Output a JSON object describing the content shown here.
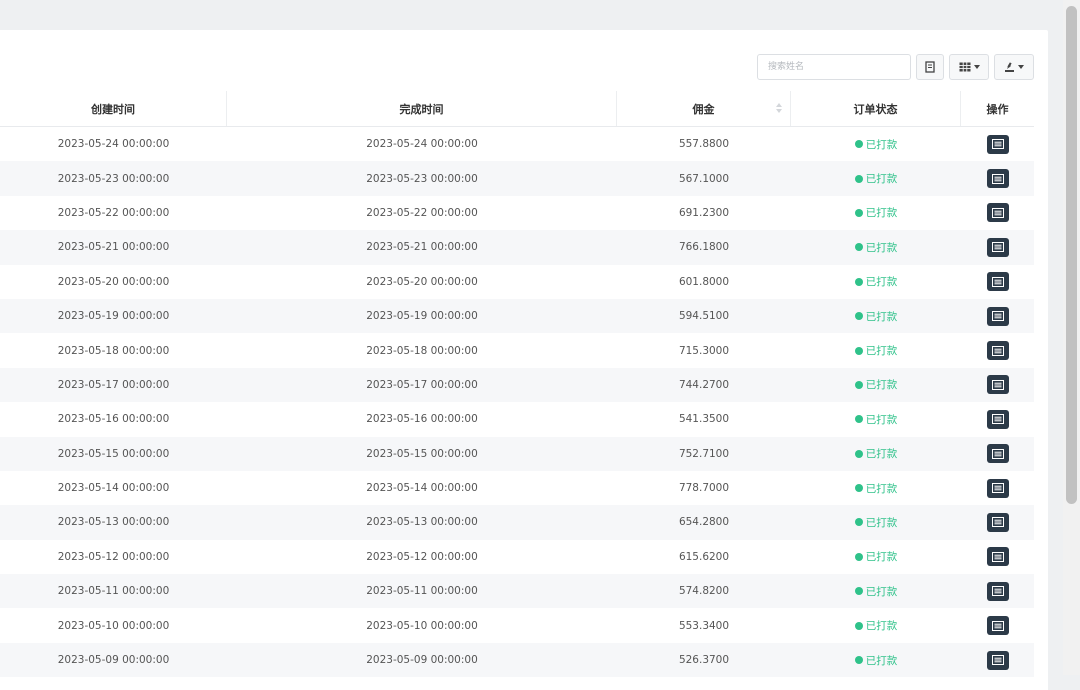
{
  "search": {
    "placeholder": "搜索姓名"
  },
  "toolbar": {
    "icons": [
      "refresh-icon",
      "columns-icon",
      "export-icon"
    ]
  },
  "table": {
    "headers": [
      "创建时间",
      "完成时间",
      "佣金",
      "订单状态",
      "操作"
    ],
    "rows": [
      {
        "created": "2023-05-24 00:00:00",
        "finished": "2023-05-24 00:00:00",
        "commission": "557.8800",
        "status": "已打款"
      },
      {
        "created": "2023-05-23 00:00:00",
        "finished": "2023-05-23 00:00:00",
        "commission": "567.1000",
        "status": "已打款"
      },
      {
        "created": "2023-05-22 00:00:00",
        "finished": "2023-05-22 00:00:00",
        "commission": "691.2300",
        "status": "已打款"
      },
      {
        "created": "2023-05-21 00:00:00",
        "finished": "2023-05-21 00:00:00",
        "commission": "766.1800",
        "status": "已打款"
      },
      {
        "created": "2023-05-20 00:00:00",
        "finished": "2023-05-20 00:00:00",
        "commission": "601.8000",
        "status": "已打款"
      },
      {
        "created": "2023-05-19 00:00:00",
        "finished": "2023-05-19 00:00:00",
        "commission": "594.5100",
        "status": "已打款"
      },
      {
        "created": "2023-05-18 00:00:00",
        "finished": "2023-05-18 00:00:00",
        "commission": "715.3000",
        "status": "已打款"
      },
      {
        "created": "2023-05-17 00:00:00",
        "finished": "2023-05-17 00:00:00",
        "commission": "744.2700",
        "status": "已打款"
      },
      {
        "created": "2023-05-16 00:00:00",
        "finished": "2023-05-16 00:00:00",
        "commission": "541.3500",
        "status": "已打款"
      },
      {
        "created": "2023-05-15 00:00:00",
        "finished": "2023-05-15 00:00:00",
        "commission": "752.7100",
        "status": "已打款"
      },
      {
        "created": "2023-05-14 00:00:00",
        "finished": "2023-05-14 00:00:00",
        "commission": "778.7000",
        "status": "已打款"
      },
      {
        "created": "2023-05-13 00:00:00",
        "finished": "2023-05-13 00:00:00",
        "commission": "654.2800",
        "status": "已打款"
      },
      {
        "created": "2023-05-12 00:00:00",
        "finished": "2023-05-12 00:00:00",
        "commission": "615.6200",
        "status": "已打款"
      },
      {
        "created": "2023-05-11 00:00:00",
        "finished": "2023-05-11 00:00:00",
        "commission": "574.8200",
        "status": "已打款"
      },
      {
        "created": "2023-05-10 00:00:00",
        "finished": "2023-05-10 00:00:00",
        "commission": "553.3400",
        "status": "已打款"
      },
      {
        "created": "2023-05-09 00:00:00",
        "finished": "2023-05-09 00:00:00",
        "commission": "526.3700",
        "status": "已打款"
      }
    ]
  },
  "colors": {
    "status_green": "#2fc28a",
    "action_button": "#2c3a48"
  }
}
